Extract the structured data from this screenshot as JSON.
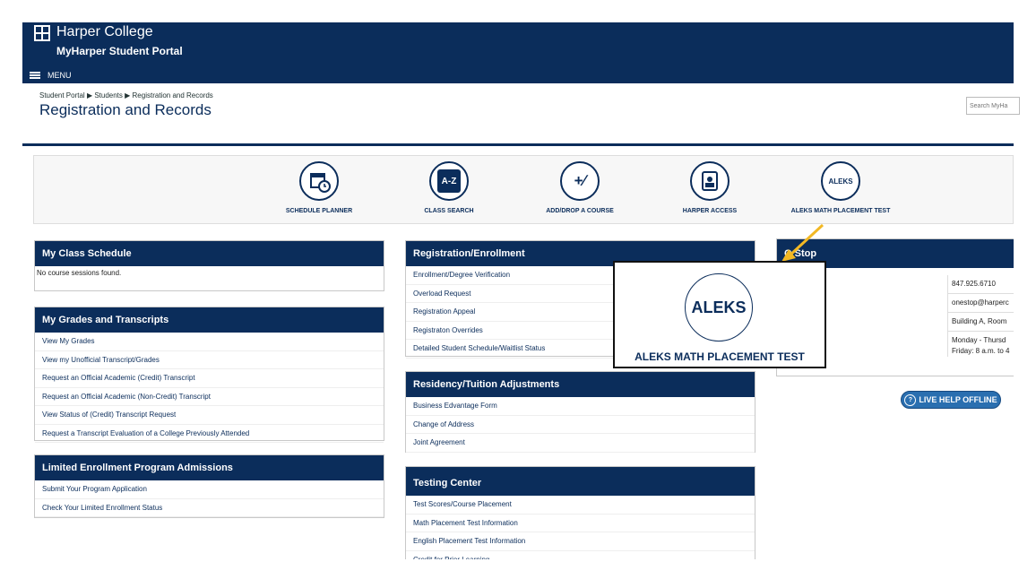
{
  "header": {
    "college": "Harper College",
    "portal": "MyHarper Student Portal",
    "menu_label": "MENU"
  },
  "breadcrumb": [
    "Student Portal",
    "Students",
    "Registration and Records"
  ],
  "page_title": "Registration and Records",
  "search": {
    "placeholder": "Search MyHa"
  },
  "quick_actions": [
    {
      "label": "SCHEDULE PLANNER",
      "icon": "calendar-clock-icon"
    },
    {
      "label": "CLASS SEARCH",
      "icon": "a-z-book-icon",
      "glyph": "A-Z"
    },
    {
      "label": "ADD/DROP A COURSE",
      "icon": "plus-minus-icon",
      "glyph": "+∕"
    },
    {
      "label": "HARPER ACCESS",
      "icon": "badge-icon"
    },
    {
      "label": "ALEKS MATH PLACEMENT TEST",
      "icon": "aleks-icon",
      "glyph": "ALEKS"
    }
  ],
  "panels": {
    "class_schedule": {
      "title": "My Class Schedule",
      "empty": "No course sessions found."
    },
    "grades": {
      "title": "My Grades and Transcripts",
      "items": [
        "View My Grades",
        "View my Unofficial Transcript/Grades",
        "Request an Official Academic (Credit) Transcript",
        "Request an Official Academic (Non-Credit) Transcript",
        "View Status of (Credit) Transcript Request",
        "Request a Transcript Evaluation of a College Previously Attended"
      ]
    },
    "limited": {
      "title": "Limited Enrollment Program Admissions",
      "items": [
        "Submit Your Program Application",
        "Check Your Limited Enrollment Status"
      ]
    },
    "registration": {
      "title": "Registration/Enrollment",
      "items": [
        "Enrollment/Degree Verification",
        "Overload Request",
        "Registration Appeal",
        "Registraton Overrides",
        "Detailed Student Schedule/Waitlist Status"
      ]
    },
    "residency": {
      "title": "Residency/Tuition Adjustments",
      "items": [
        "Business Edvantage Form",
        "Change of Address",
        "Joint Agreement"
      ]
    },
    "testing": {
      "title": "Testing Center",
      "items": [
        "Test Scores/Course Placement",
        "Math Placement Test Information",
        "English Placement Test Information",
        "Credit for Prior Learning"
      ]
    },
    "onestop": {
      "title": "One Stop",
      "title_visible": "O   Stop",
      "rows": [
        "847.925.6710",
        "onestop@harperc",
        "Building A, Room",
        "Monday - Thursd",
        "Friday: 8 a.m. to 4"
      ]
    }
  },
  "popup": {
    "glyph": "ALEKS",
    "label": "ALEKS MATH PLACEMENT TEST"
  },
  "live_help": {
    "label": "LIVE HELP OFFLINE"
  },
  "colors": {
    "navy": "#0b2d5b",
    "arrow": "#f2b824",
    "live_help": "#2a6fb0"
  }
}
